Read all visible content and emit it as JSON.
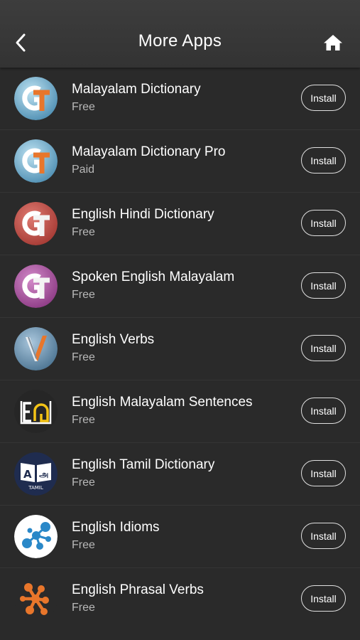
{
  "header": {
    "title": "More Apps",
    "back_icon": "chevron-left-icon",
    "home_icon": "home-icon"
  },
  "apps": [
    {
      "name": "Malayalam Dictionary",
      "price": "Free",
      "install_label": "Install",
      "icon": "gt-blue-icon"
    },
    {
      "name": "Malayalam Dictionary Pro",
      "price": "Paid",
      "install_label": "Install",
      "icon": "gt-blue-icon"
    },
    {
      "name": "English Hindi Dictionary",
      "price": "Free",
      "install_label": "Install",
      "icon": "gt-red-icon"
    },
    {
      "name": "Spoken English Malayalam",
      "price": "Free",
      "install_label": "Install",
      "icon": "gt-purple-icon"
    },
    {
      "name": "English Verbs",
      "price": "Free",
      "install_label": "Install",
      "icon": "verbs-v-icon"
    },
    {
      "name": "English Malayalam Sentences",
      "price": "Free",
      "install_label": "Install",
      "icon": "e-malayalam-icon"
    },
    {
      "name": "English Tamil Dictionary",
      "price": "Free",
      "install_label": "Install",
      "icon": "tamil-book-icon"
    },
    {
      "name": "English Idioms",
      "price": "Free",
      "install_label": "Install",
      "icon": "idioms-network-icon"
    },
    {
      "name": "English Phrasal Verbs",
      "price": "Free",
      "install_label": "Install",
      "icon": "phrasal-network-icon"
    }
  ],
  "tamil_icon_text": "TAMIL",
  "colors": {
    "header_bg": "#383838",
    "list_bg": "#2a2a2a",
    "text_primary": "#ffffff",
    "text_secondary": "#b8b8b8",
    "divider": "#353535"
  }
}
